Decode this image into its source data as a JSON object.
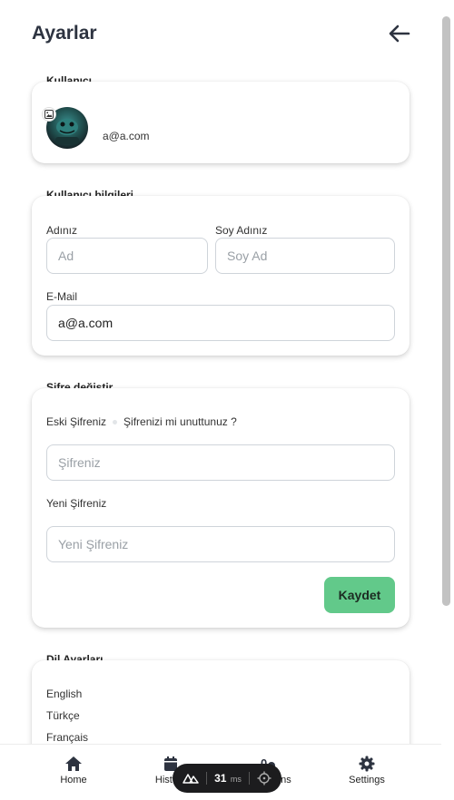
{
  "header": {
    "title": "Ayarlar"
  },
  "user_section": {
    "label": "Kullanıcı",
    "email": "a@a.com"
  },
  "info_section": {
    "label": "Kullanıcı bilgileri",
    "first_name_label": "Adınız",
    "first_name_placeholder": "Ad",
    "last_name_label": "Soy Adınız",
    "last_name_placeholder": "Soy Ad",
    "email_label": "E-Mail",
    "email_value": "a@a.com"
  },
  "password_section": {
    "label": "Şifre değiştir",
    "old_password_label": "Eski Şifreniz",
    "forgot_link": "Şifrenizi mi unuttunuz ?",
    "old_password_placeholder": "Şifreniz",
    "new_password_label": "Yeni Şifreniz",
    "new_password_placeholder": "Yeni Şifreniz",
    "save_label": "Kaydet"
  },
  "language_section": {
    "label": "Dil Ayarları",
    "items": [
      "English",
      "Türkçe",
      "Français"
    ]
  },
  "bottom_nav": {
    "items": [
      {
        "label": "Home",
        "icon": "home-icon"
      },
      {
        "label": "History",
        "icon": "calendar-icon"
      },
      {
        "label": "Questions",
        "icon": "questions-icon"
      },
      {
        "label": "Settings",
        "icon": "gear-icon"
      }
    ]
  },
  "dev_toolbar": {
    "ms_value": "31",
    "ms_unit": "ms"
  },
  "colors": {
    "accent_green": "#62c98a",
    "title": "#2d3340",
    "dev_toolbar_bg": "#1c1c1e"
  }
}
